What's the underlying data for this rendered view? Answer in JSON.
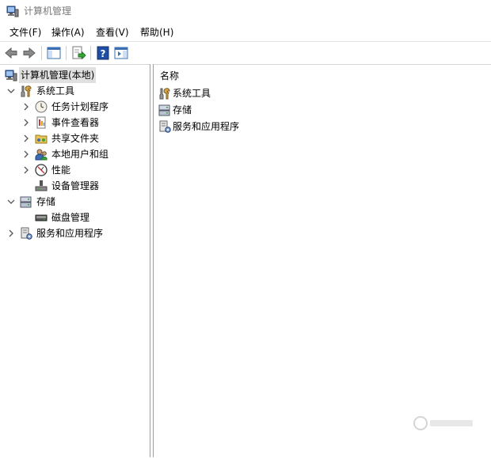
{
  "window": {
    "title": "计算机管理"
  },
  "menu": [
    {
      "label": "文件(F)"
    },
    {
      "label": "操作(A)"
    },
    {
      "label": "查看(V)"
    },
    {
      "label": "帮助(H)"
    }
  ],
  "toolbar": {
    "buttons": [
      "back-icon",
      "forward-icon",
      "show-tree-icon",
      "export-list-icon",
      "help-icon",
      "action-pane-icon"
    ]
  },
  "tree": {
    "root": "计算机管理(本地)",
    "system_tools": "系统工具",
    "task_scheduler": "任务计划程序",
    "event_viewer": "事件查看器",
    "shared_folders": "共享文件夹",
    "local_users_groups": "本地用户和组",
    "performance": "性能",
    "device_manager": "设备管理器",
    "storage": "存储",
    "disk_management": "磁盘管理",
    "services_apps": "服务和应用程序"
  },
  "content": {
    "column_header": "名称",
    "items": [
      {
        "label": "系统工具"
      },
      {
        "label": "存储"
      },
      {
        "label": "服务和应用程序"
      }
    ]
  },
  "colors": {
    "selection": "#e0e0e0",
    "title_text": "#7a7a7a",
    "divider": "#9e9e9e"
  }
}
